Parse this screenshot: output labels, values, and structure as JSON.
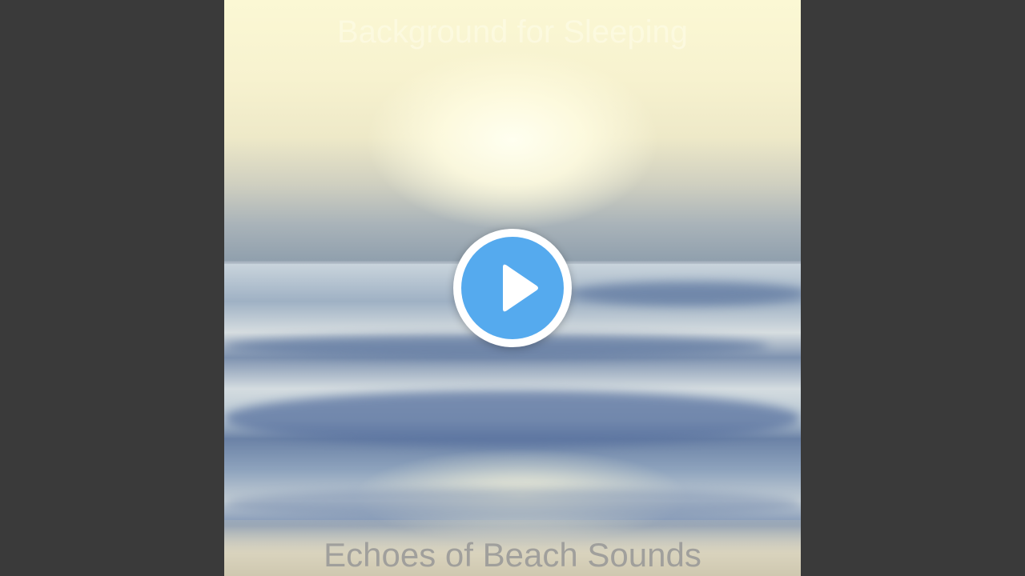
{
  "artwork": {
    "top_title": "Background for Sleeping",
    "bottom_title": "Echoes of Beach Sounds"
  },
  "player": {
    "play_icon": "play-icon",
    "accent_color": "#55aaee",
    "background_color": "#3a3a3a"
  }
}
